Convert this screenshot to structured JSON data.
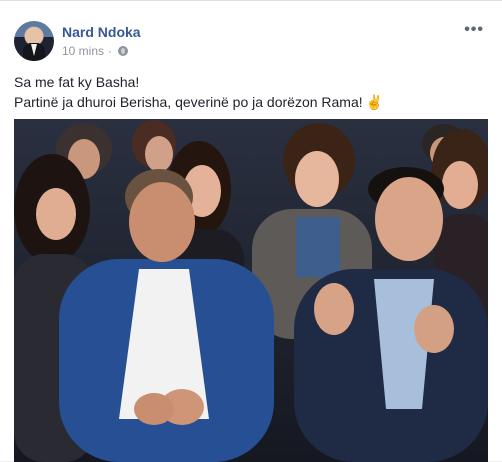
{
  "post": {
    "author": "Nard Ndoka",
    "time": "10 mins",
    "separator": "·",
    "more_label": "•••",
    "text_line1": "Sa me fat ky Basha!",
    "text_line2": "Partinë ja dhuroi Berisha, qeverinë po ja dorëzon Rama!",
    "emoji": "✌"
  },
  "icons": {
    "privacy": "globe-icon",
    "more": "more-options-icon"
  },
  "colors": {
    "author_link": "#365899",
    "meta_text": "#90949c",
    "body_text": "#1d2129"
  }
}
